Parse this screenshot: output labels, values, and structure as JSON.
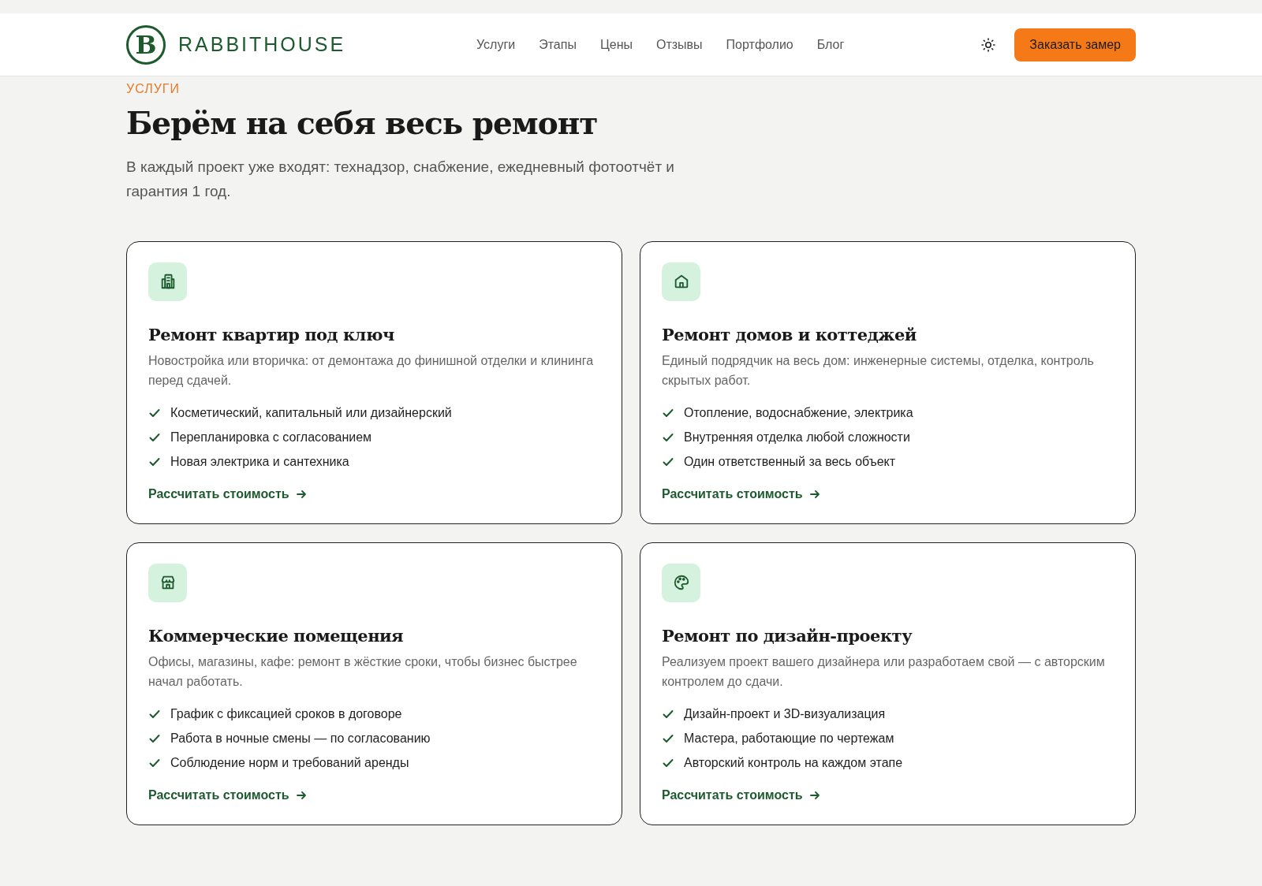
{
  "header": {
    "logo_mark": "B",
    "logo_text": "RABBITHOUSE",
    "nav": [
      {
        "label": "Услуги"
      },
      {
        "label": "Этапы"
      },
      {
        "label": "Цены"
      },
      {
        "label": "Отзывы"
      },
      {
        "label": "Портфолио"
      },
      {
        "label": "Блог"
      }
    ],
    "cta": "Заказать замер"
  },
  "section": {
    "eyebrow": "УСЛУГИ",
    "title": "Берём на себя весь ремонт",
    "lead": "В каждый проект уже входят: технадзор, снабжение, ежедневный фотоотчёт и гарантия 1 год."
  },
  "cards": [
    {
      "title": "Ремонт квартир под ключ",
      "text": "Новостройка или вторичка: от демонтажа до финишной отделки и клининга перед сдачей.",
      "features": [
        "Косметический, капитальный или дизайнерский",
        "Перепланировка с согласованием",
        "Новая электрика и сантехника"
      ],
      "link": "Рассчитать стоимость"
    },
    {
      "title": "Ремонт домов и коттеджей",
      "text": "Единый подрядчик на весь дом: инженерные системы, отделка, контроль скрытых работ.",
      "features": [
        "Отопление, водоснабжение, электрика",
        "Внутренняя отделка любой сложности",
        "Один ответственный за весь объект"
      ],
      "link": "Рассчитать стоимость"
    },
    {
      "title": "Коммерческие помещения",
      "text": "Офисы, магазины, кафе: ремонт в жёсткие сроки, чтобы бизнес быстрее начал работать.",
      "features": [
        "График с фиксацией сроков в договоре",
        "Работа в ночные смены — по согласованию",
        "Соблюдение норм и требований аренды"
      ],
      "link": "Рассчитать стоимость"
    },
    {
      "title": "Ремонт по дизайн-проекту",
      "text": "Реализуем проект вашего дизайнера или разработаем свой — с авторским контролем до сдачи.",
      "features": [
        "Дизайн-проект и 3D-визуализация",
        "Мастера, работающие по чертежам",
        "Авторский контроль на каждом этапе"
      ],
      "link": "Рассчитать стоимость"
    }
  ]
}
